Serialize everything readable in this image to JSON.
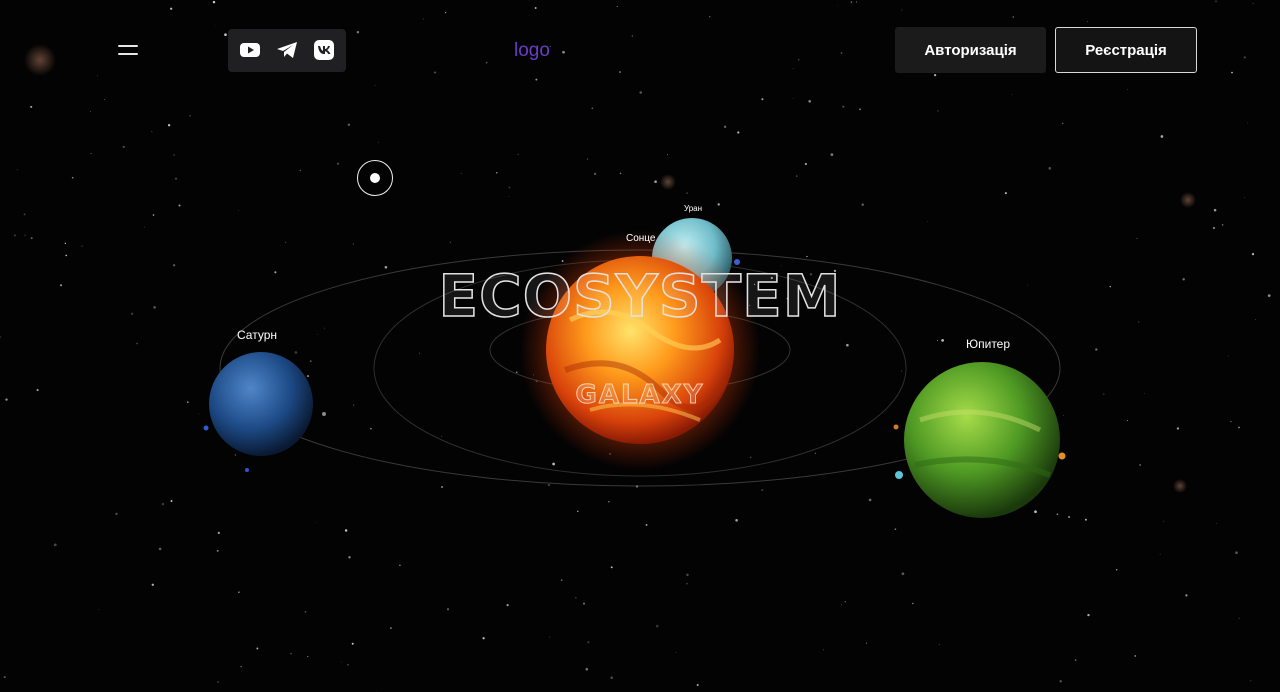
{
  "header": {
    "menu_icon": "hamburger-menu-icon",
    "social": [
      {
        "icon": "youtube-icon"
      },
      {
        "icon": "telegram-icon"
      },
      {
        "icon": "vk-icon"
      }
    ],
    "logo": "logo",
    "login_label": "Авторизація",
    "register_label": "Реєстрація"
  },
  "hero": {
    "title": "ECOSYSTEM",
    "subtitle": "GALAXY",
    "planets": {
      "sun": "Сонце",
      "uranus": "Уран",
      "saturn": "Сатурн",
      "jupiter": "Юпитер"
    }
  },
  "colors": {
    "background": "#030304",
    "logo": "#6a3cc7",
    "button_dark": "#1b1b1c",
    "sun": "#f07a1a",
    "jupiter": "#5fae2a",
    "saturn": "#1f4f91",
    "uranus": "#7ecbd6"
  }
}
